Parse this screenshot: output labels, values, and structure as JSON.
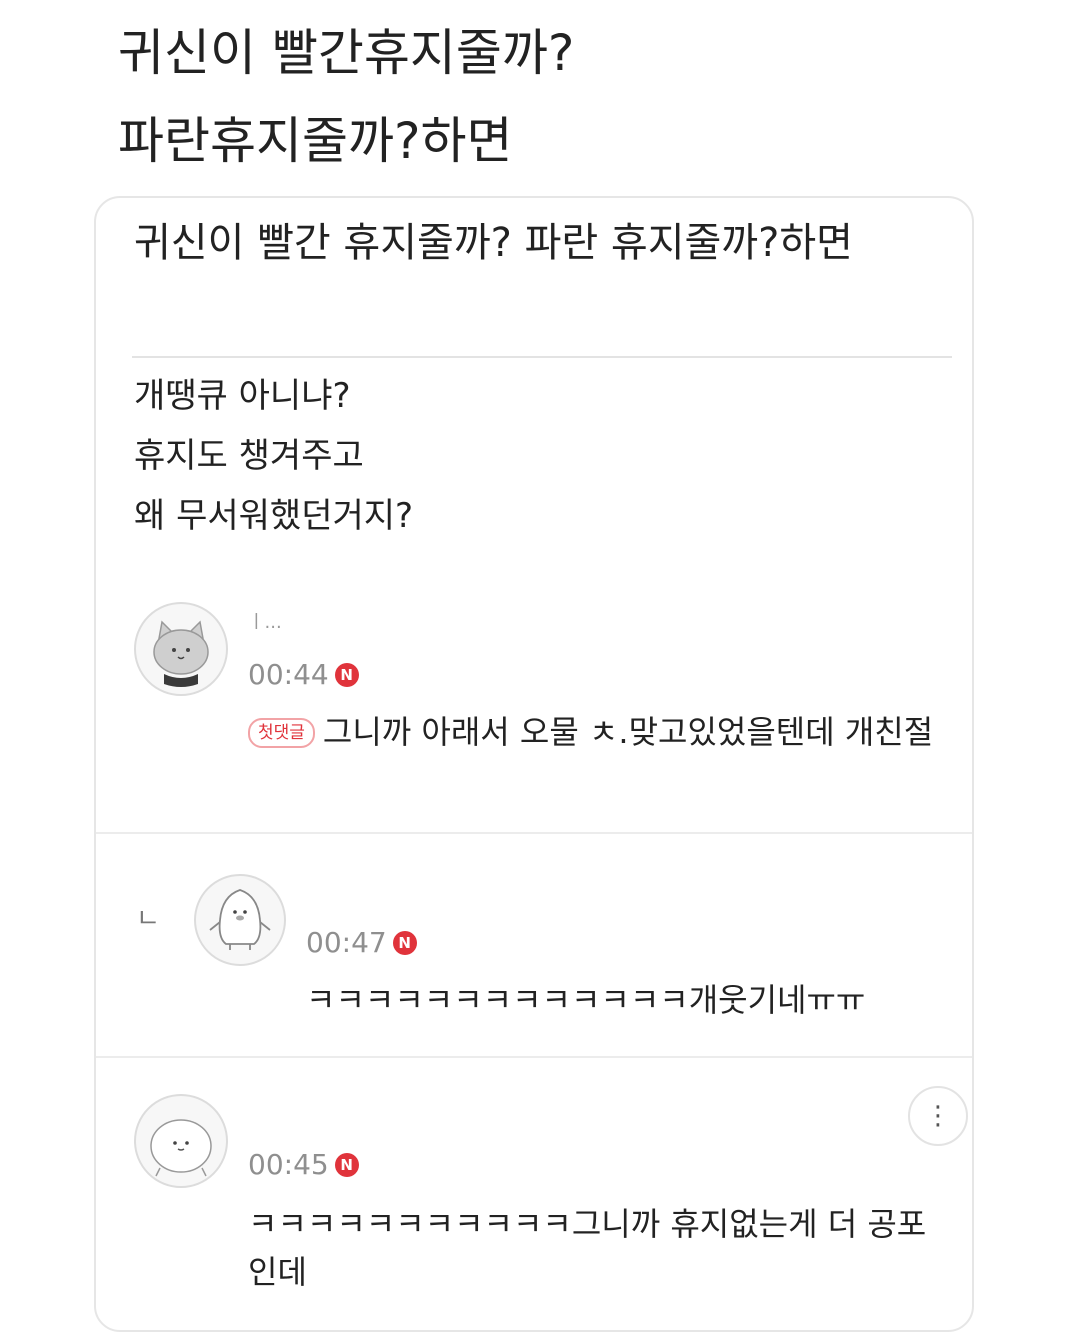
{
  "caption": {
    "line1": "귀신이 빨간휴지줄까?",
    "line2": "파란휴지줄까?하면"
  },
  "post": {
    "title": "귀신이 빨간 휴지줄까? 파란 휴지줄까?하면",
    "body": [
      "개땡큐 아니냐?",
      "휴지도 챙겨주고",
      "왜 무서워했던거지?"
    ]
  },
  "comments": [
    {
      "author": "ㅣ...",
      "time": "00:44",
      "new_badge": "N",
      "first_badge": "첫댓글",
      "text": "그니까 아래서 오물 ㅊ.맞고있었을텐데 개친절",
      "avatar_icon": "cat-avatar-icon"
    },
    {
      "reply_marker": "ㄴ",
      "time": "00:47",
      "new_badge": "N",
      "text": "ㅋㅋㅋㅋㅋㅋㅋㅋㅋㅋㅋㅋㅋ개웃기네ㅠㅠ",
      "avatar_icon": "penguin-avatar-icon"
    },
    {
      "time": "00:45",
      "new_badge": "N",
      "text": "ㅋㅋㅋㅋㅋㅋㅋㅋㅋㅋㅋ그니까 휴지없는게 더 공포인데",
      "avatar_icon": "round-face-avatar-icon",
      "more_icon": "vertical-dots-icon",
      "more_label": "⋮"
    }
  ]
}
